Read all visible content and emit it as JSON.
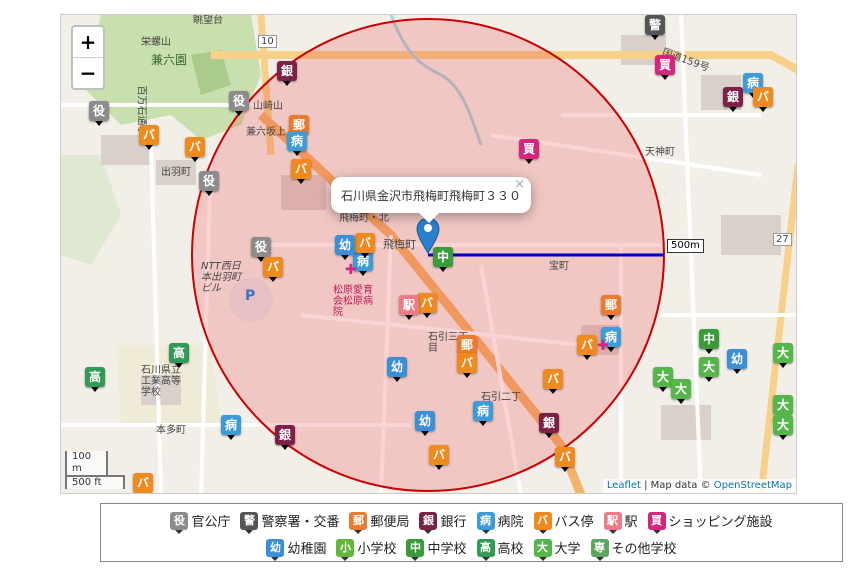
{
  "map": {
    "zoom_in": "+",
    "zoom_out": "−",
    "popup_text": "石川県金沢市飛梅町飛梅町３３０",
    "popup_close": "×",
    "radius_label": "500m",
    "scale_metric": "100 m",
    "scale_imperial": "500 ft",
    "attribution_leaflet": "Leaflet",
    "attribution_sep": " | Map data © ",
    "attribution_osm": "OpenStreetMap",
    "circle_color": "#cc0000",
    "radius_line_color": "#0000cc",
    "place_labels": [
      "兼六園",
      "出羽町",
      "飛梅町",
      "宝町",
      "天神町",
      "本多町",
      "石引三丁目",
      "石引二丁目",
      "NTT西日本出羽町ビル",
      "石川県立工業高等学校",
      "松原愛育会松原病院",
      "国道159号",
      "兼六坂上",
      "山崎山",
      "百万石通り",
      "飛梅町・北",
      "栄螺山",
      "眺望台",
      "10",
      "27",
      "P"
    ]
  },
  "pins": [
    {
      "type": "government",
      "glyph": "役",
      "color": "#8c8c8c"
    },
    {
      "type": "police",
      "glyph": "警",
      "color": "#555555"
    },
    {
      "type": "post",
      "glyph": "郵",
      "color": "#ea7a2d"
    },
    {
      "type": "bank",
      "glyph": "銀",
      "color": "#7d2048"
    },
    {
      "type": "hospital",
      "glyph": "病",
      "color": "#3d9bd8"
    },
    {
      "type": "bus",
      "glyph": "バ",
      "color": "#ef8a1e"
    },
    {
      "type": "station",
      "glyph": "駅",
      "color": "#ec7b86"
    },
    {
      "type": "shopping",
      "glyph": "買",
      "color": "#d4267e"
    },
    {
      "type": "kindergarten",
      "glyph": "幼",
      "color": "#3b8fd6"
    },
    {
      "type": "elementary",
      "glyph": "小",
      "color": "#63b73a"
    },
    {
      "type": "junior_high",
      "glyph": "中",
      "color": "#3a9b3a"
    },
    {
      "type": "high_school",
      "glyph": "高",
      "color": "#2f9b56"
    },
    {
      "type": "university",
      "glyph": "大",
      "color": "#56b64b"
    },
    {
      "type": "other_school",
      "glyph": "専",
      "color": "#5aa65a"
    }
  ],
  "legend": {
    "row1": [
      {
        "glyph": "役",
        "label": "官公庁",
        "color": "#8c8c8c"
      },
      {
        "glyph": "警",
        "label": "警察署・交番",
        "color": "#555555"
      },
      {
        "glyph": "郵",
        "label": "郵便局",
        "color": "#ea7a2d"
      },
      {
        "glyph": "銀",
        "label": "銀行",
        "color": "#7d2048"
      },
      {
        "glyph": "病",
        "label": "病院",
        "color": "#3d9bd8"
      },
      {
        "glyph": "バ",
        "label": "バス停",
        "color": "#ef8a1e"
      },
      {
        "glyph": "駅",
        "label": "駅",
        "color": "#ec7b86"
      },
      {
        "glyph": "買",
        "label": "ショッピング施設",
        "color": "#d4267e"
      }
    ],
    "row2": [
      {
        "glyph": "幼",
        "label": "幼稚園",
        "color": "#3b8fd6"
      },
      {
        "glyph": "小",
        "label": "小学校",
        "color": "#63b73a"
      },
      {
        "glyph": "中",
        "label": "中学校",
        "color": "#3a9b3a"
      },
      {
        "glyph": "高",
        "label": "高校",
        "color": "#2f9b56"
      },
      {
        "glyph": "大",
        "label": "大学",
        "color": "#56b64b"
      },
      {
        "glyph": "専",
        "label": "その他学校",
        "color": "#5aa65a"
      }
    ]
  }
}
